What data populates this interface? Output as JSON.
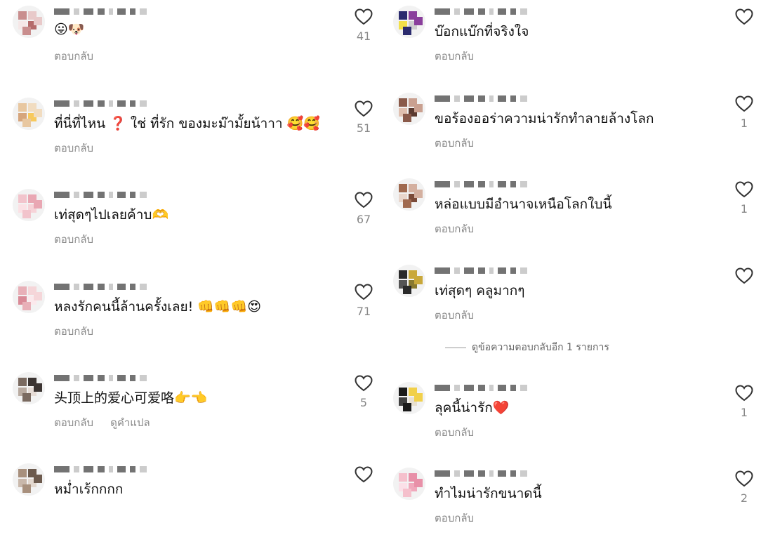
{
  "reply_label": "ตอบกลับ",
  "left": [
    {
      "text": "😛🐶",
      "likes": "41",
      "avatar": [
        "#c98e8e",
        "#e8c9c9",
        "#f5e7e7",
        "#b56b6b"
      ]
    },
    {
      "text": "ที่นี่ที่ไหน ❓ ใช่ ที่รัก ของมะม๊ามั้ยน้าาา 🥰🥰",
      "likes": "51",
      "avatar": [
        "#e8c7a0",
        "#f1dcc0",
        "#d6a57c",
        "#f7c95d"
      ]
    },
    {
      "text": "เท่สุดๆไปเลยค้าบ🫶",
      "likes": "67",
      "avatar": [
        "#f2c4cc",
        "#e9a7b3",
        "#fbe1e5",
        "#f6d3d8"
      ]
    },
    {
      "text": "หลงรักคนนี้ล้านครั้งเลย! 👊👊👊😍",
      "likes": "71",
      "avatar": [
        "#e8b0b8",
        "#f5d6d9",
        "#d98a97",
        "#fbe9ec"
      ]
    },
    {
      "text": "头顶上的爱心可爱咯👉👈",
      "likes": "5",
      "avatar": [
        "#7a6a60",
        "#3c3532",
        "#b8aaa0",
        "#e6dcd6"
      ],
      "translate": "ดูคำแปล"
    },
    {
      "text": "หม่ำเร้กกกก",
      "likes": "",
      "avatar": [
        "#a8907d",
        "#6d5b4e",
        "#c9b8ab",
        "#e3d8cf"
      ]
    }
  ],
  "right": [
    {
      "text": "บ๊อกแบ๊กที่จริงใจ",
      "likes": "",
      "avatar": [
        "#2b2b6e",
        "#8a3f9c",
        "#f1e04a",
        "#cfcfcf"
      ]
    },
    {
      "text": "ขอร้องออร่าความน่ารักทำลายล้างโลก",
      "likes": "1",
      "avatar": [
        "#8a5a4a",
        "#c9a090",
        "#e0c0b0",
        "#5a3a30"
      ]
    },
    {
      "text": "หล่อแบบมีอำนาจเหนือโลกใบนี้",
      "likes": "1",
      "avatar": [
        "#a06a50",
        "#d4b0a0",
        "#e8d6cc",
        "#7a4a38"
      ]
    },
    {
      "text": "เท่สุดๆ คลูมากๆ",
      "likes": "",
      "avatar": [
        "#2a2a2a",
        "#c9a83a",
        "#555",
        "#8a7a30"
      ]
    },
    {
      "text": "ลุคนี้น่ารัก❤️",
      "likes": "1",
      "avatar": [
        "#1a1a1a",
        "#f1d04a",
        "#404040",
        "#e8e0d0"
      ]
    },
    {
      "text": "ทำไมน่ารักขนาดนี้",
      "likes": "2",
      "avatar": [
        "#f5c0cc",
        "#e890a8",
        "#fbe0e8",
        "#f0a8bc"
      ]
    }
  ],
  "view_more_replies": "ดูข้อความตอบกลับอีก 1 รายการ"
}
